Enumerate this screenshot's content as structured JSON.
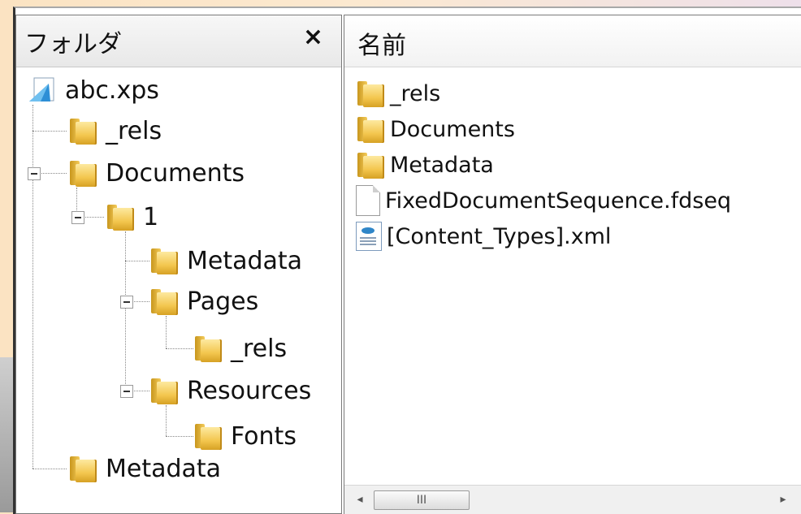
{
  "folder_pane": {
    "title": "フォルダ",
    "close_label": "×"
  },
  "tree": {
    "root": "abc.xps",
    "items": [
      {
        "label": "_rels"
      },
      {
        "label": "Documents"
      },
      {
        "label": "1"
      },
      {
        "label": "Metadata"
      },
      {
        "label": "Pages"
      },
      {
        "label": "_rels"
      },
      {
        "label": "Resources"
      },
      {
        "label": "Fonts"
      },
      {
        "label": "Metadata"
      }
    ]
  },
  "list": {
    "column": "名前",
    "items": [
      {
        "label": "_rels",
        "icon": "folder-icon"
      },
      {
        "label": "Documents",
        "icon": "folder-icon"
      },
      {
        "label": "Metadata",
        "icon": "folder-icon"
      },
      {
        "label": "FixedDocumentSequence.fdseq",
        "icon": "file-icon"
      },
      {
        "label": "[Content_Types].xml",
        "icon": "xml-file-icon"
      }
    ]
  },
  "scrollbar": {
    "left_arrow": "◂",
    "right_arrow": "▸",
    "thumb_grip": "III"
  }
}
